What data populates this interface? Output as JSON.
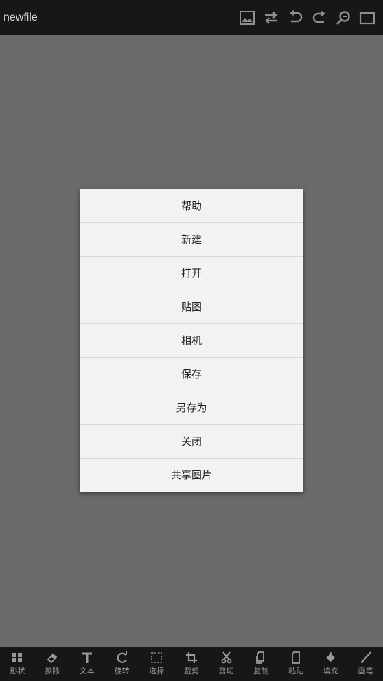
{
  "topbar": {
    "title": "newfile",
    "actions": [
      {
        "icon": "image-icon"
      },
      {
        "icon": "swap-icon"
      },
      {
        "icon": "undo-icon"
      },
      {
        "icon": "redo-icon"
      },
      {
        "icon": "zoom-icon"
      },
      {
        "icon": "fullscreen-icon"
      }
    ]
  },
  "menu": {
    "items": [
      "帮助",
      "新建",
      "打开",
      "贴图",
      "相机",
      "保存",
      "另存为",
      "关闭",
      "共享图片"
    ]
  },
  "toolbar": {
    "tools": [
      {
        "label": "形状",
        "icon": "shapes-icon"
      },
      {
        "label": "擦除",
        "icon": "eraser-icon"
      },
      {
        "label": "文本",
        "icon": "text-icon"
      },
      {
        "label": "旋转",
        "icon": "rotate-icon"
      },
      {
        "label": "选择",
        "icon": "select-icon"
      },
      {
        "label": "裁剪",
        "icon": "crop-icon"
      },
      {
        "label": "剪切",
        "icon": "cut-icon"
      },
      {
        "label": "复制",
        "icon": "copy-icon"
      },
      {
        "label": "粘贴",
        "icon": "paste-icon"
      },
      {
        "label": "填充",
        "icon": "fill-icon"
      },
      {
        "label": "画笔",
        "icon": "brush-icon"
      }
    ]
  },
  "colors": {
    "bar_bg": "#161719",
    "canvas_bg": "#6a6a6a",
    "menu_bg": "#f2f2f2",
    "icon_color": "#9a9a9a"
  }
}
